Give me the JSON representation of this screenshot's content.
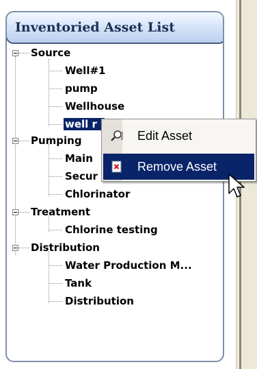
{
  "panel": {
    "title": "Inventoried Asset List"
  },
  "tree": [
    {
      "label": "Source",
      "children": [
        "Well#1",
        "pump",
        "Wellhouse",
        "well r"
      ]
    },
    {
      "label": "Pumping",
      "children": [
        "Main",
        "Secur",
        "Chlorinator"
      ]
    },
    {
      "label": "Treatment",
      "children": [
        "Chlorine testing"
      ]
    },
    {
      "label": "Distribution",
      "children": [
        "Water Production M...",
        "Tank",
        "Distribution"
      ]
    }
  ],
  "context_menu": {
    "items": [
      {
        "label": "Edit Asset",
        "icon": "magnifier-icon",
        "highlighted": false
      },
      {
        "label": "Remove Asset",
        "icon": "remove-icon",
        "highlighted": true
      }
    ]
  },
  "colors": {
    "selection": "#0a246a",
    "header_border": "#4a5a78",
    "title_text": "#1c2f55"
  }
}
